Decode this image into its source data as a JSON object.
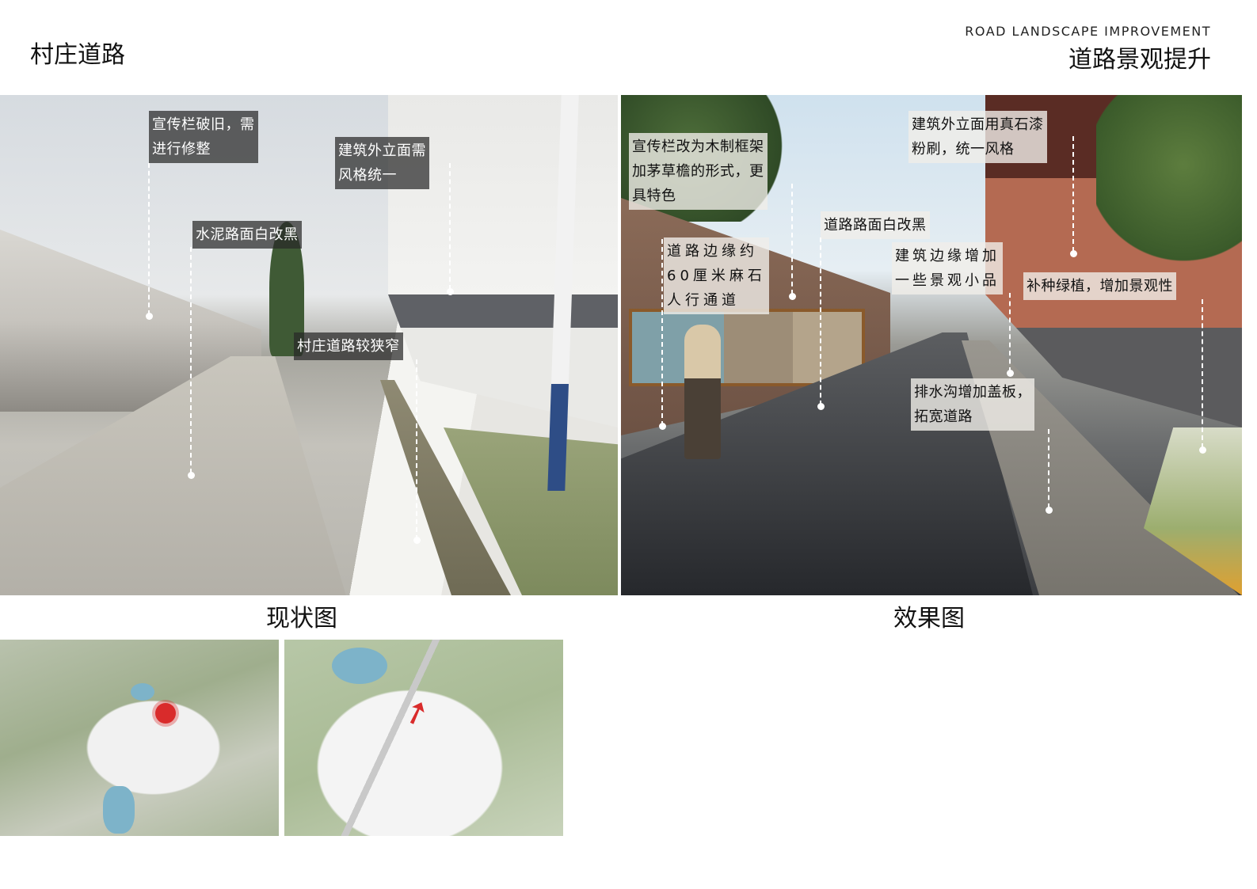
{
  "header": {
    "title": "村庄道路",
    "subtitle_en": "ROAD LANDSCAPE IMPROVEMENT",
    "subtitle_cn": "道路景观提升"
  },
  "photo_current": {
    "caption": "现状图",
    "labels": [
      "宣传栏破旧，需\n进行修整",
      "建筑外立面需\n风格统一",
      "水泥路面白改黑",
      "村庄道路较狭窄"
    ]
  },
  "photo_effect": {
    "caption": "效果图",
    "labels": [
      "宣传栏改为木制框架\n加茅草檐的形式，更\n具特色",
      "建筑外立面用真石漆\n粉刷，统一风格",
      "道路路面白改黑",
      "道路边缘约\n60厘米麻石\n人行通道",
      "建筑边缘增加\n一些景观小品",
      "补种绿植，增加景观性",
      "排水沟增加盖板，\n拓宽道路"
    ]
  },
  "maps": {
    "current": {
      "marker": "location-dot-icon"
    },
    "plan": {
      "marker": "view-direction-arrow-icon"
    }
  }
}
